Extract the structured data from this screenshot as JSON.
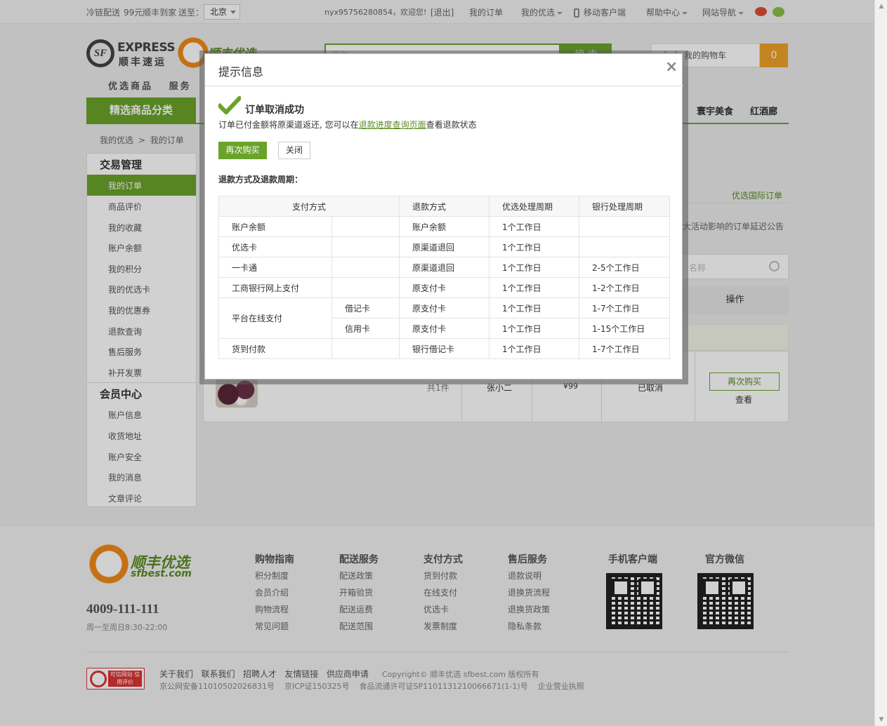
{
  "topbar": {
    "cold_chain": "冷链配送",
    "free_delivery": "99元顺丰到家",
    "ship_to_label": "送至：",
    "city": "北京",
    "user": "nyx95756280854，欢迎您!",
    "logout": "[退出]",
    "my_orders": "我的订单",
    "my_sfbest": "我的优选",
    "mobile": "移动客户端",
    "help": "帮助中心",
    "site_nav": "网站导航"
  },
  "header": {
    "express_en": "EXPRESS",
    "express_cn": "顺丰速运",
    "sfbest_cn": "顺丰优选",
    "search_placeholder": "易鲜",
    "search_button": "搜 索",
    "cart_label": "我的购物车",
    "cart_count": "0",
    "nav_products": "优选商品",
    "nav_service": "服务",
    "category_title": "精选商品分类",
    "nav_right": [
      "寰宇美食",
      "红酒廊"
    ]
  },
  "breadcrumb": {
    "home": "我的优选",
    "sep": ">",
    "current": "我的订单"
  },
  "sidebar": {
    "trade_title": "交易管理",
    "trade_items": [
      "我的订单",
      "商品评价",
      "我的收藏",
      "账户余额",
      "我的积分",
      "我的优选卡",
      "我的优惠券",
      "退款查询",
      "售后服务",
      "补开发票"
    ],
    "member_title": "会员中心",
    "member_items": [
      "账户信息",
      "收货地址",
      "账户安全",
      "我的消息",
      "文章评论"
    ]
  },
  "main": {
    "intl_orders": "优选国际订单",
    "notice": "大活动影响的订单延迟公告",
    "search_placeholder": "名称",
    "col_action": "操作",
    "order": {
      "qty": "共1件",
      "receiver": "张小二",
      "amount": "¥99",
      "status": "已取消",
      "buy_again": "再次购买",
      "view": "查看"
    }
  },
  "modal": {
    "title": "提示信息",
    "close_symbol": "×",
    "success": "订单取消成功",
    "desc_before": "订单已付金额将原渠道返还, 您可以在",
    "desc_link": "退款进度查询页面",
    "desc_after": "查看退款状态",
    "buy_again": "再次购买",
    "close": "关闭",
    "subtitle": "退款方式及退款周期：",
    "table": {
      "headers": [
        "支付方式",
        "退款方式",
        "优选处理周期",
        "银行处理周期"
      ],
      "rows": [
        {
          "pay": "账户余额",
          "sub": "",
          "refund": "账户余额",
          "sf": "1个工作日",
          "bank": ""
        },
        {
          "pay": "优选卡",
          "sub": "",
          "refund": "原渠道退回",
          "sf": "1个工作日",
          "bank": ""
        },
        {
          "pay": "一卡通",
          "sub": "",
          "refund": "原渠道退回",
          "sf": "1个工作日",
          "bank": "2-5个工作日"
        },
        {
          "pay": "工商银行网上支付",
          "sub": "",
          "refund": "原支付卡",
          "sf": "1个工作日",
          "bank": "1-2个工作日"
        },
        {
          "pay": "平台在线支付",
          "sub": "借记卡",
          "refund": "原支付卡",
          "sf": "1个工作日",
          "bank": "1-7个工作日"
        },
        {
          "pay": "",
          "sub": "信用卡",
          "refund": "原支付卡",
          "sf": "1个工作日",
          "bank": "1-15个工作日"
        },
        {
          "pay": "货到付款",
          "sub": "",
          "refund": "银行借记卡",
          "sf": "1个工作日",
          "bank": "1-7个工作日"
        }
      ]
    }
  },
  "footer": {
    "logo_cn": "顺丰优选",
    "logo_url": "sfbest.com",
    "phone": "4009-111-111",
    "hours": "周一至周日8:30-22:00",
    "columns": [
      {
        "title": "购物指南",
        "links": [
          "积分制度",
          "会员介绍",
          "购物流程",
          "常见问题"
        ]
      },
      {
        "title": "配送服务",
        "links": [
          "配送政策",
          "开箱验货",
          "配送运费",
          "配送范围"
        ]
      },
      {
        "title": "支付方式",
        "links": [
          "货到付款",
          "在线支付",
          "优选卡",
          "发票制度"
        ]
      },
      {
        "title": "售后服务",
        "links": [
          "退款说明",
          "退换货流程",
          "退换货政策",
          "隐私条款"
        ]
      }
    ],
    "app_title": "手机客户端",
    "wechat_title": "官方微信",
    "bottom_links": [
      "关于我们",
      "联系我们",
      "招聘人才",
      "友情链接",
      "供应商申请"
    ],
    "copyright": "Copyright© 顺丰优选 sfbest.com 版权所有",
    "licenses": [
      "京公网安备11010502026831号",
      "京ICP证150325号",
      "食品流通许可证SP1101131210066671(1-1)号",
      "企业营业执照"
    ],
    "badge": "可信网站 信用评价"
  },
  "colors": {
    "brand_green": "#6aa32a",
    "cart_orange": "#f0a22a",
    "link_green": "#5a8c22"
  }
}
